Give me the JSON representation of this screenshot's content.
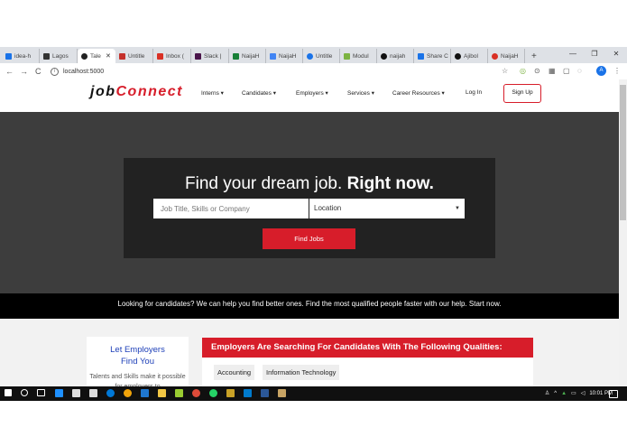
{
  "browser": {
    "tabs": [
      {
        "label": "idea-h",
        "color": "#1a73e8"
      },
      {
        "label": "Lagos",
        "color": "#333333"
      },
      {
        "label": "Tale",
        "color": "#222222"
      },
      {
        "label": "Untitle",
        "color": "#c4302b"
      },
      {
        "label": "Inbox (",
        "color": "#d93025"
      },
      {
        "label": "Slack |",
        "color": "#4a154b"
      },
      {
        "label": "NaijaH",
        "color": "#188038"
      },
      {
        "label": "NaijaH",
        "color": "#4285f4"
      },
      {
        "label": "Untitle",
        "color": "#1a73e8"
      },
      {
        "label": "Modul",
        "color": "#7cb342"
      },
      {
        "label": "naijah",
        "color": "#111111"
      },
      {
        "label": "Share C",
        "color": "#1a73e8"
      },
      {
        "label": "Ajibol",
        "color": "#111111"
      },
      {
        "label": "NaijaH",
        "color": "#d93025"
      }
    ],
    "new_tab": "+",
    "window_controls": {
      "minimize": "—",
      "restore": "❐",
      "close": "✕"
    },
    "nav": {
      "back": "←",
      "forward": "→",
      "reload": "C"
    },
    "url": "localhost:5000",
    "profile_initial": "A"
  },
  "site": {
    "logo_job": "job",
    "logo_connect": "Connect",
    "nav": [
      "Interns ▾",
      "Candidates ▾",
      "Employers ▾",
      "Services ▾",
      "Career Resources ▾",
      "Log In"
    ],
    "signup": "Sign Up"
  },
  "hero": {
    "title_normal": "Find your dream job.",
    "title_bold": "Right now.",
    "search_placeholder": "Job Title, Skills or Company",
    "location_placeholder": "Location",
    "find_button": "Find Jobs"
  },
  "band_text": "Looking for candidates? We can help you find better ones. Find the most qualified people faster with our help. Start now.",
  "employer_card": {
    "title_line1": "Let Employers",
    "title_line2": "Find You",
    "text": "Talents and Skills make it possible for employers to"
  },
  "qualities": {
    "header": "Employers Are Searching For Candidates With The Following Qualities:",
    "chips": [
      "Accounting",
      "Information Technology"
    ]
  },
  "taskbar": {
    "clock": "10:01 PM",
    "tray_text": "ENG"
  },
  "colors": {
    "accent": "#d71d2a",
    "link_blue": "#1d3fb8",
    "hero_bg": "#3d3d3d"
  }
}
